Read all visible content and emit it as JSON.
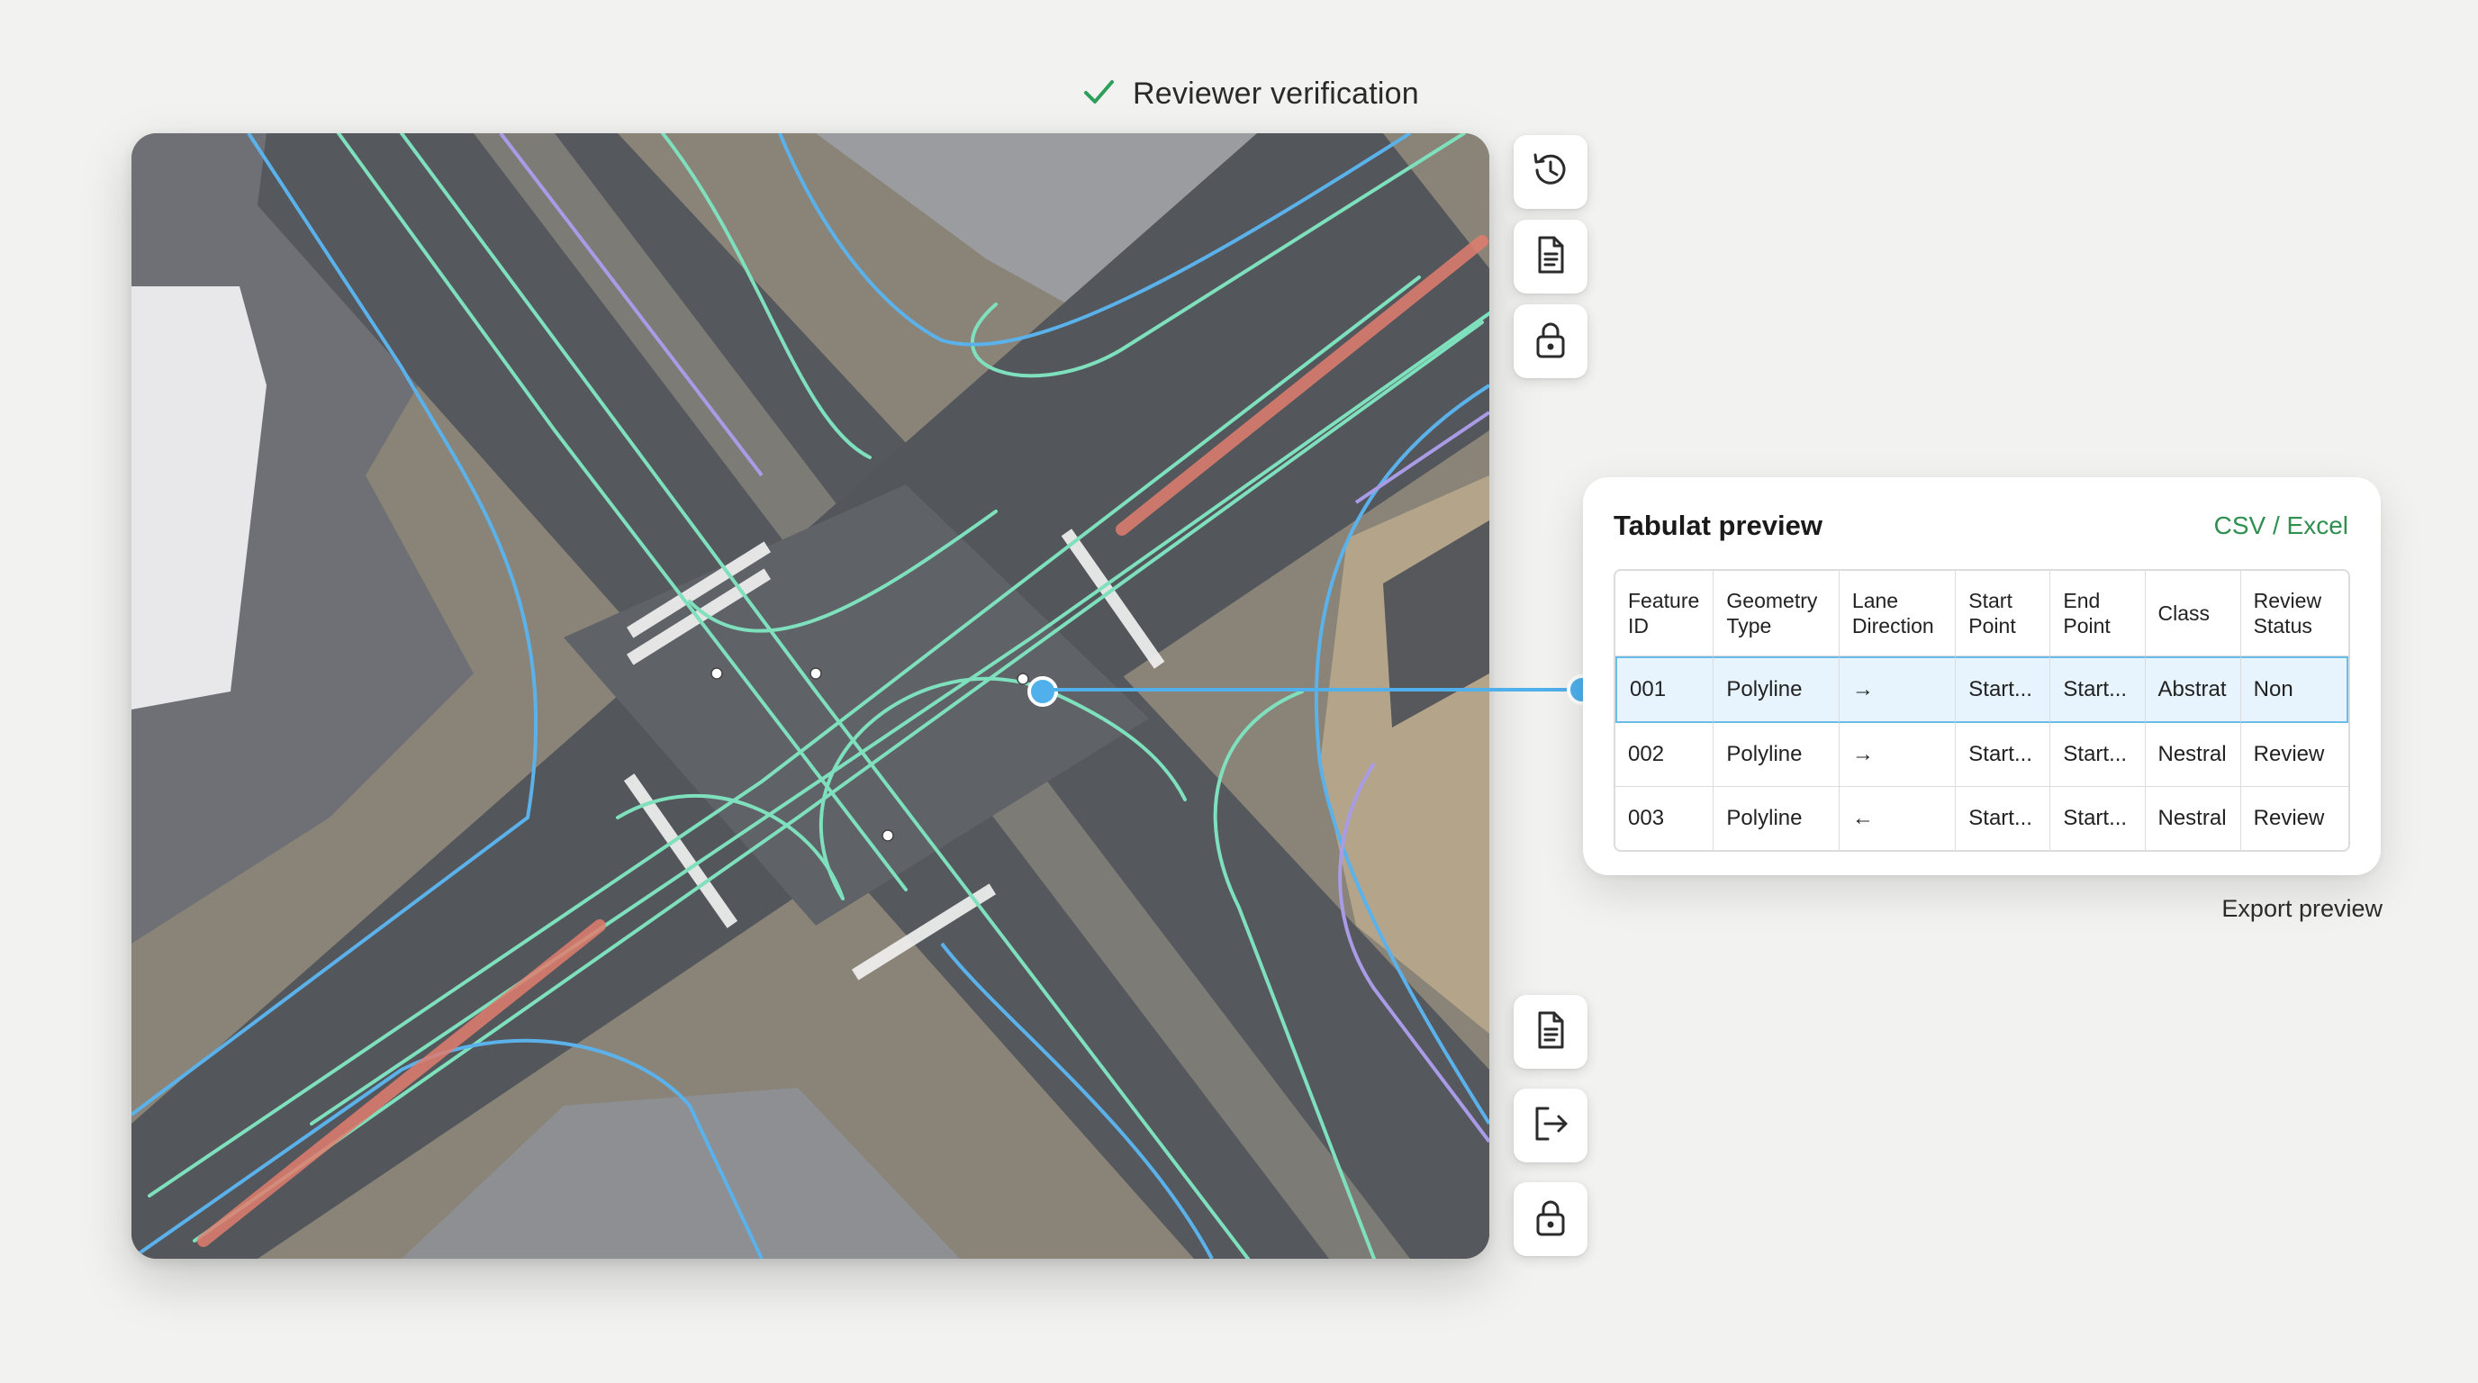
{
  "header": {
    "verification_label": "Reviewer verification",
    "check_icon": "check-icon",
    "accent_color": "#2e9e5b"
  },
  "map": {
    "description_icon": "aerial-map-image",
    "lane_colors": {
      "lane_line": "#7ee0bd",
      "road_edge": "#5bb2ea",
      "rail_line": "#a99be6",
      "bike_lane": "#e07d6f"
    }
  },
  "toolbar_top": [
    {
      "name": "history-icon"
    },
    {
      "name": "document-icon"
    },
    {
      "name": "lock-icon"
    }
  ],
  "toolbar_bottom": [
    {
      "name": "document-icon"
    },
    {
      "name": "export-icon"
    },
    {
      "name": "lock-icon"
    }
  ],
  "table_panel": {
    "title": "Tabulat preview",
    "link": "CSV / Excel",
    "columns": [
      "Feature ID",
      "Geometry Type",
      "Lane Direction",
      "Start Point",
      "End Point",
      "Class",
      "Review Status"
    ],
    "rows": [
      [
        "001",
        "Polyline",
        "→",
        "Start...",
        "Start...",
        "Abstrat",
        "Non"
      ],
      [
        "002",
        "Polyline",
        "→",
        "Start...",
        "Start...",
        "Nestral",
        "Review"
      ],
      [
        "003",
        "Polyline",
        "←",
        "Start...",
        "Start...",
        "Nestral",
        "Review"
      ]
    ],
    "selected_row": 0,
    "selection_color": "#6bbde8"
  },
  "footer": {
    "export_label": "Export preview"
  }
}
